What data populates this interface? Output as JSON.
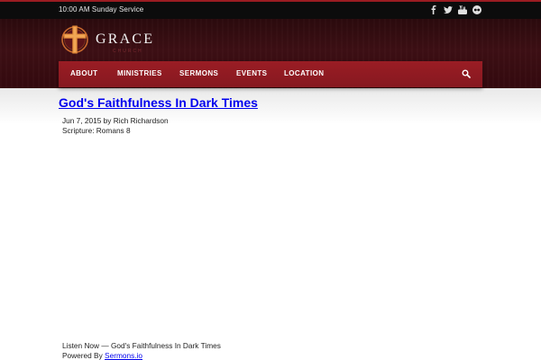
{
  "topbar": {
    "service_text": "10:00 AM Sunday Service",
    "social": [
      "facebook-icon",
      "twitter-icon",
      "youtube-icon",
      "flickr-icon"
    ]
  },
  "brand": {
    "name": "GRACE",
    "tagline": "CHURCH",
    "colors": {
      "primary": "#8f1b22",
      "header_bg": "#3a0e13",
      "topbar_bg": "#0c0c0c"
    }
  },
  "nav": {
    "items": [
      "ABOUT",
      "MINISTRIES",
      "SERMONS",
      "EVENTS",
      "LOCATION"
    ],
    "search_icon": "search-icon"
  },
  "post": {
    "title": "God's Faithfulness In Dark Times",
    "date_author": "Jun 7, 2015 by Rich Richardson",
    "scripture": "Scripture: Romans 8"
  },
  "player": {
    "listen_text": "Listen Now — God's Faithfulness In Dark Times",
    "powered_prefix": "Powered By ",
    "powered_link": "Sermons.io"
  }
}
